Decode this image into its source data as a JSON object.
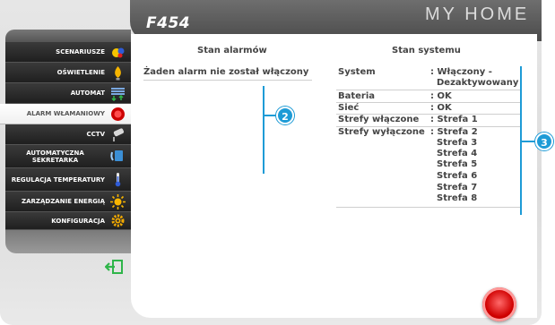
{
  "header": {
    "model": "F454",
    "brand": "MY HOME"
  },
  "sidebar": {
    "items": [
      {
        "label": "SCENARIUSZE",
        "icon": "scenario-icon"
      },
      {
        "label": "OŚWIETLENIE",
        "icon": "light-bulb-icon"
      },
      {
        "label": "AUTOMAT",
        "icon": "shutter-icon"
      },
      {
        "label": "ALARM WŁAMANIOWY",
        "icon": "alarm-icon",
        "active": true
      },
      {
        "label": "CCTV",
        "icon": "camera-icon"
      },
      {
        "label": "AUTOMATYCZNA SEKRETARKA",
        "icon": "answering-machine-icon"
      },
      {
        "label": "REGULACJA TEMPERATURY",
        "icon": "thermometer-icon"
      },
      {
        "label": "ZARZĄDZANIE ENERGIĄ",
        "icon": "energy-icon"
      },
      {
        "label": "KONFIGURACJA",
        "icon": "gear-icon"
      }
    ],
    "exit_icon": "exit-icon"
  },
  "alarms": {
    "title": "Stan alarmów",
    "message": "Żaden alarm nie został włączony",
    "callout": "2"
  },
  "system": {
    "title": "Stan systemu",
    "rows": [
      {
        "label": "System",
        "value": ": Włączony -",
        "value2": "Dezaktywowany"
      },
      {
        "label": "Bateria",
        "value": ": OK"
      },
      {
        "label": "Sieć",
        "value": ": OK"
      },
      {
        "label": "Strefy włączone",
        "value": ": Strefa 1"
      },
      {
        "label": "Strefy wyłączone",
        "value": ": Strefa 2"
      }
    ],
    "extra_zones": [
      "Strefa 3",
      "Strefa 4",
      "Strefa 5",
      "Strefa 6",
      "Strefa 7",
      "Strefa 8"
    ],
    "callout": "3"
  },
  "colors": {
    "callout": "#1e9bd6",
    "alarm": "#d00000"
  }
}
